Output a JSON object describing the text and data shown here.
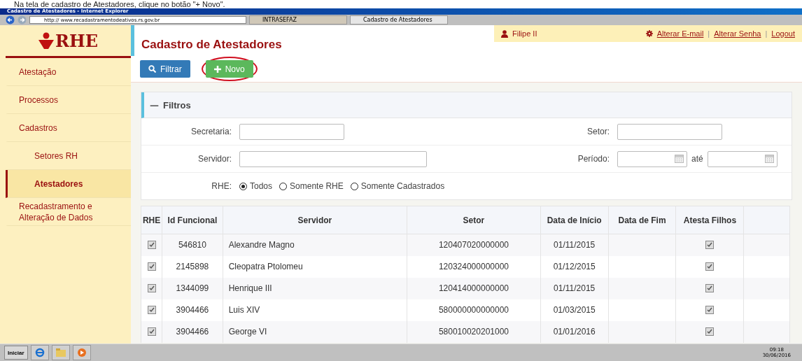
{
  "caption": "Na tela de cadastro de Atestadores, clique no botão \"+ Novo\".",
  "window": {
    "title": "Cadastro de Atestadores - Internet Explorer"
  },
  "browser": {
    "address": "http:// www.recadastramentodeativos.rs.gov.br",
    "tabs": [
      {
        "label": "INTRASEFAZ",
        "selected": false
      },
      {
        "label": "Cadastro de Atestadores",
        "selected": true
      }
    ]
  },
  "logo": "RHE",
  "user": {
    "name": "Filipe II",
    "links": [
      "Alterar E-mail",
      "Alterar Senha",
      "Logout"
    ],
    "separator": "|"
  },
  "sidebar": {
    "items": [
      {
        "label": "Atestação",
        "selected": false
      },
      {
        "label": "Processos",
        "selected": false
      },
      {
        "label": "Cadastros",
        "selected": false,
        "children": [
          {
            "label": "Setores RH",
            "selected": false
          },
          {
            "label": "Atestadores",
            "selected": true
          }
        ]
      },
      {
        "label": "Recadastramento e Alteração de Dados",
        "selected": false
      }
    ]
  },
  "page_title": "Cadastro de Atestadores",
  "toolbar": {
    "buttons": [
      {
        "label": "Filtrar",
        "kind": "filter"
      },
      {
        "label": "Novo",
        "kind": "new",
        "highlighted": true
      }
    ]
  },
  "filters": {
    "title": "Filtros",
    "collapse_icon": "—",
    "secretaria_label": "Secretaria:",
    "setor_label": "Setor:",
    "servidor_label": "Servidor:",
    "periodo_label": "Período:",
    "ate": "até",
    "rhe_label": "RHE:",
    "rhe_options": [
      {
        "label": "Todos",
        "selected": true
      },
      {
        "label": "Somente RHE",
        "selected": false
      },
      {
        "label": "Somente Cadastrados",
        "selected": false
      }
    ]
  },
  "table": {
    "columns": [
      "RHE",
      "Id Funcional",
      "Servidor",
      "Setor",
      "Data de Início",
      "Data de Fim",
      "Atesta Filhos"
    ],
    "rows": [
      {
        "rhe": true,
        "id": "546810",
        "servidor": "Alexandre Magno",
        "setor": "120407020000000",
        "inicio": "01/11/2015",
        "atesta_filhos": true
      },
      {
        "rhe": true,
        "id": "2145898",
        "servidor": "Cleopatra Ptolomeu",
        "setor": "120324000000000",
        "inicio": "01/12/2015",
        "atesta_filhos": true
      },
      {
        "rhe": true,
        "id": "1344099",
        "servidor": "Henrique III",
        "setor": "120414000000000",
        "inicio": "01/11/2015",
        "atesta_filhos": true
      },
      {
        "rhe": true,
        "id": "3904466",
        "servidor": "Luis XIV",
        "setor": "580000000000000",
        "inicio": "01/03/2015",
        "atesta_filhos": true
      },
      {
        "rhe": true,
        "id": "3904466",
        "servidor": "George VI",
        "setor": "580010020201000",
        "inicio": "01/01/2016",
        "atesta_filhos": true
      }
    ]
  },
  "taskbar": {
    "start": "Iniciar",
    "time": "09:18",
    "date": "30/06/2016"
  }
}
